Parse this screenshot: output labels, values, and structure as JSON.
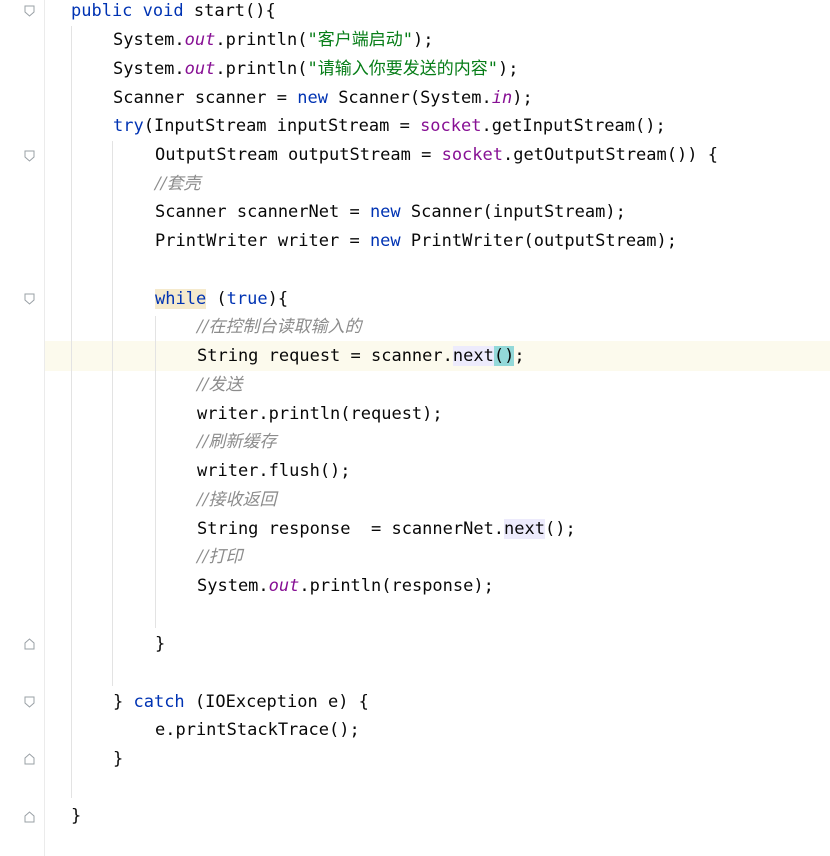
{
  "editor": {
    "language": "Java",
    "accent_colors": {
      "keyword": "#0033b3",
      "static_field": "#871094",
      "string": "#067d17",
      "comment": "#8c8c8c",
      "current_line": "#fcfaed",
      "brace_match": "#93d9d9"
    },
    "lines": {
      "l1": {
        "kw1": "public",
        "kw2": "void",
        "rest": " start(){"
      },
      "l2": {
        "a": "System.",
        "b": "out",
        "c": ".println(",
        "s": "\"客户端启动\"",
        "d": ");"
      },
      "l3": {
        "a": "System.",
        "b": "out",
        "c": ".println(",
        "s": "\"请输入你要发送的内容\"",
        "d": ");"
      },
      "l4": {
        "a": "Scanner scanner = ",
        "kw": "new",
        "b": " Scanner(System.",
        "f": "in",
        "c": ");"
      },
      "l5": {
        "kw": "try",
        "a": "(InputStream inputStream = ",
        "m": "socket",
        "b": ".getInputStream();"
      },
      "l6": {
        "a": "OutputStream outputStream = ",
        "m": "socket",
        "b": ".getOutputStream()) {"
      },
      "l7": {
        "cmt": "//套壳"
      },
      "l8": {
        "a": "Scanner scannerNet = ",
        "kw": "new",
        "b": " Scanner(inputStream);"
      },
      "l9": {
        "a": "PrintWriter writer = ",
        "kw": "new",
        "b": " PrintWriter(outputStream);"
      },
      "l10": {
        "kw": "while",
        "a": " (",
        "kw2": "true",
        "b": "){"
      },
      "l11": {
        "cmt": "//在控制台读取输入的"
      },
      "l12": {
        "a": "String request = scanner.",
        "m": "next",
        "p": "()",
        "b": ";"
      },
      "l13": {
        "cmt": "//发送"
      },
      "l14": {
        "a": "writer.println(request);"
      },
      "l15": {
        "cmt": "//刷新缓存"
      },
      "l16": {
        "a": "writer.flush();"
      },
      "l17": {
        "cmt": "//接收返回"
      },
      "l18": {
        "a": "String response  = scannerNet.",
        "m": "next",
        "b": "();"
      },
      "l19": {
        "cmt": "//打印"
      },
      "l20": {
        "a": "System.",
        "f": "out",
        "b": ".println(response);"
      },
      "l21": {
        "a": "}"
      },
      "l22": {
        "a": "} ",
        "kw": "catch",
        "b": " (IOException e) {"
      },
      "l23": {
        "a": "e.printStackTrace();"
      },
      "l24": {
        "a": "}"
      },
      "l25": {
        "a": "}"
      }
    }
  }
}
